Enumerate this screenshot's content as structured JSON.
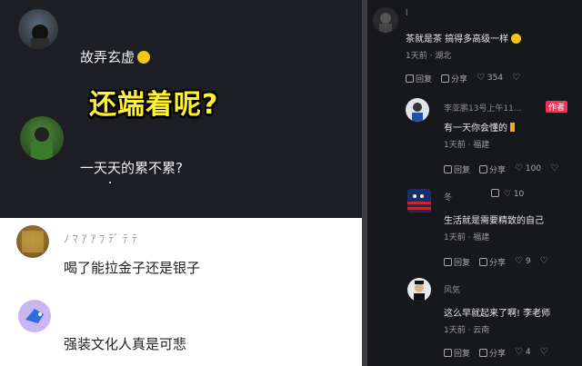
{
  "left_top": {
    "comment1": "故弄玄虚",
    "banner": "还端着呢?",
    "comment2": "一天天的累不累?"
  },
  "left_bottom": {
    "name1": "ﾉ ﾏ ｱ ｱ ﾌ ﾃﾞ ﾃ ﾃ",
    "comment1": "喝了能拉金子还是银子",
    "comment2": "强装文化人真是可悲"
  },
  "right": {
    "c1": {
      "name": "l",
      "text": "茶就是茶 搞得多高级一样",
      "meta": "1天前 · 湖北",
      "reply": "回复",
      "share": "分享",
      "likes": "354"
    },
    "c2": {
      "name": "李亚鹏13号上午11...",
      "badge": "作者",
      "text": "有一天你会懂的",
      "meta": "1天前 · 福建",
      "reply": "回复",
      "share": "分享",
      "likes": "100"
    },
    "c3": {
      "name": "冬",
      "likes_top": "10",
      "text": "生活就是需要精致的自己",
      "meta": "1天前 · 福建",
      "reply": "回复",
      "share": "分享",
      "likes": "9"
    },
    "c4": {
      "name": "风気",
      "text": "这么早就起来了啊! 李老师",
      "meta": "1天前 · 云南",
      "reply": "回复",
      "share": "分享",
      "likes": "4"
    }
  },
  "colors": {
    "banner": "#fff12e",
    "author_badge": "#ff2d55"
  }
}
